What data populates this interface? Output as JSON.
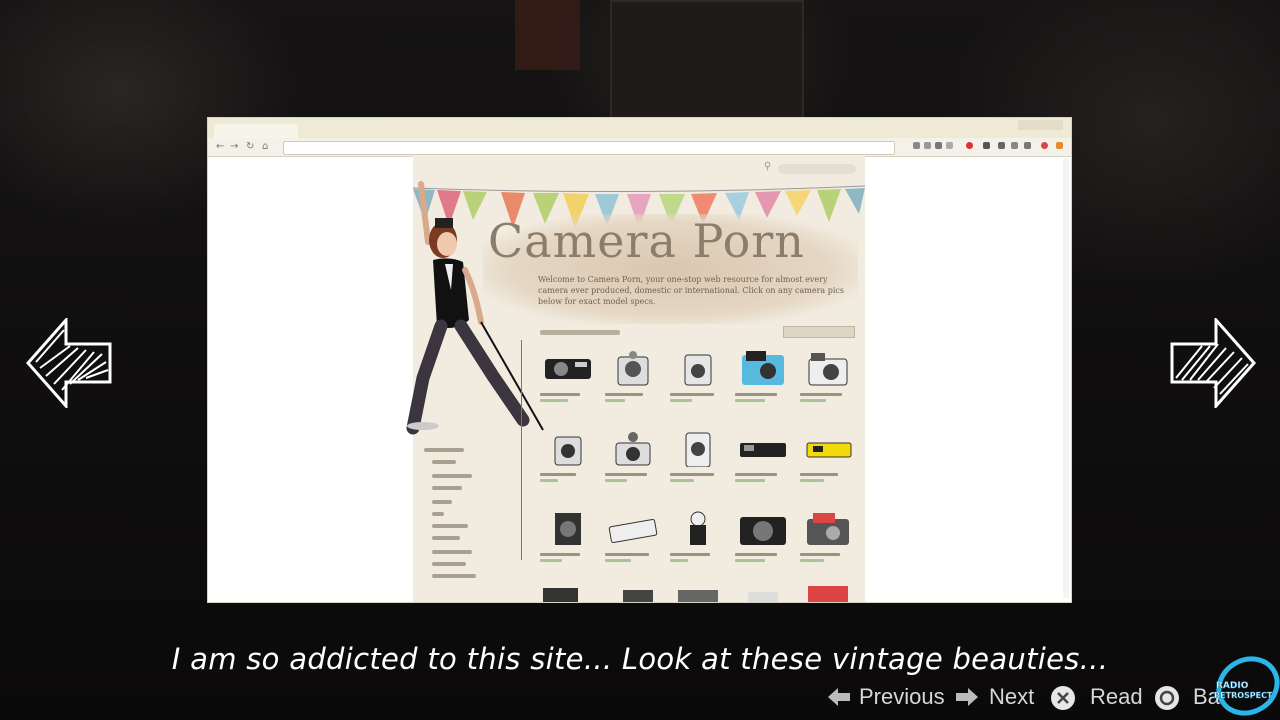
{
  "subtitle": "I am so addicted to this site...  Look at these vintage beauties...",
  "controls": {
    "previous": "Previous",
    "next": "Next",
    "read": "Read",
    "back": "Ba"
  },
  "site": {
    "title": "Camera Porn",
    "welcome": "Welcome to Camera Porn, your one-stop web resource for almost every camera ever produced, domestic or international. Click on any camera pics below for exact model specs."
  },
  "watermark": {
    "line1": "RADIO",
    "line2": "RETROSPECT"
  },
  "colors": {
    "accent_red": "#c94a3a",
    "bunting": [
      "#8fb8c4",
      "#e0798a",
      "#b9d27a",
      "#e98a6a",
      "#f2d36b",
      "#9dc9d8",
      "#e7a6c0",
      "#c1d98b",
      "#f08a72",
      "#a8cfe0",
      "#f5d77a",
      "#e497b0"
    ]
  }
}
